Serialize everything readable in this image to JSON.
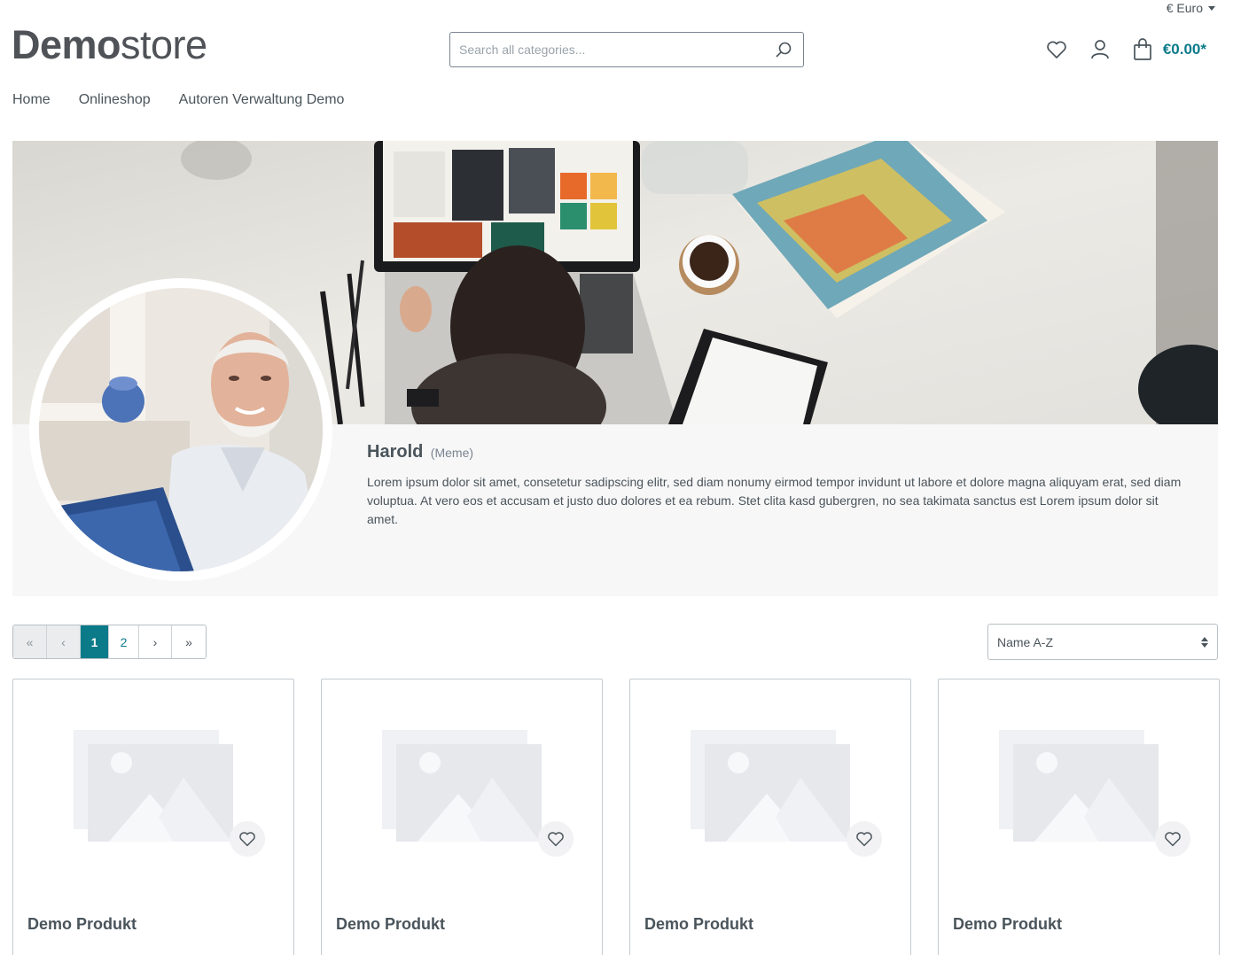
{
  "topbar": {
    "currency_label": "€ Euro"
  },
  "header": {
    "logo_bold": "Demo",
    "logo_light": "store",
    "search_placeholder": "Search all categories...",
    "cart_total": "€0.00*"
  },
  "nav": {
    "items": [
      "Home",
      "Onlineshop",
      "Autoren Verwaltung Demo"
    ]
  },
  "author": {
    "name": "Harold",
    "subtitle": "(Meme)",
    "bio": "Lorem ipsum dolor sit amet, consetetur sadipscing elitr, sed diam nonumy eirmod tempor invidunt ut labore et dolore magna aliquyam erat, sed diam voluptua. At vero eos et accusam et justo duo dolores et ea rebum. Stet clita kasd gubergren, no sea takimata sanctus est Lorem ipsum dolor sit amet."
  },
  "pagination": {
    "first": "«",
    "prev": "‹",
    "pages": [
      "1",
      "2"
    ],
    "current": "1",
    "next": "›",
    "last": "»"
  },
  "sort": {
    "selected": "Name A-Z"
  },
  "products": [
    {
      "name": "Demo Produkt"
    },
    {
      "name": "Demo Produkt"
    },
    {
      "name": "Demo Produkt"
    },
    {
      "name": "Demo Produkt"
    }
  ],
  "colors": {
    "accent": "#0b7b8a",
    "text": "#4a545b",
    "panel_bg": "#f7f7f7"
  }
}
